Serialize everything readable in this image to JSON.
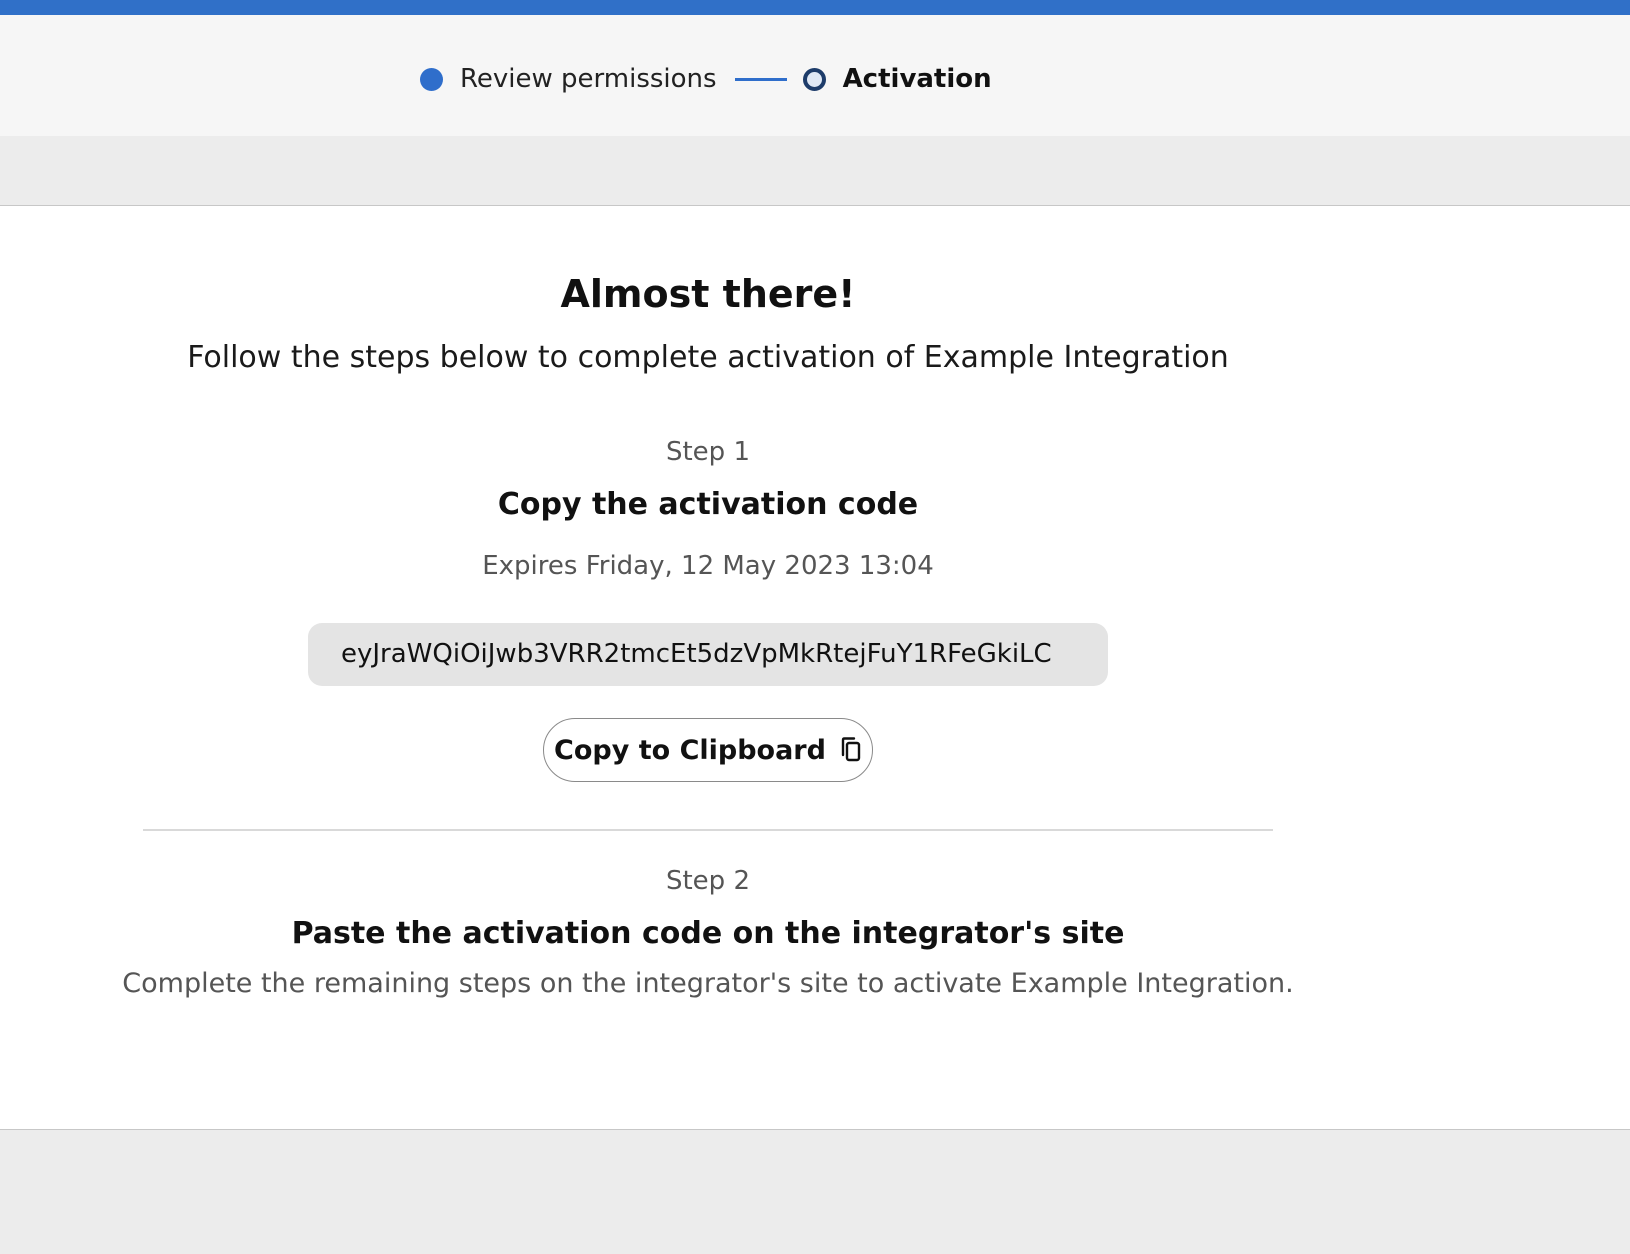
{
  "stepper": {
    "steps": [
      {
        "label": "Review permissions",
        "state": "completed"
      },
      {
        "label": "Activation",
        "state": "current"
      }
    ]
  },
  "main": {
    "title": "Almost there!",
    "subtitle": "Follow the steps below to complete activation of Example Integration"
  },
  "step1": {
    "number": "Step 1",
    "heading": "Copy the activation code",
    "expires": "Expires Friday, 12 May 2023 13:04",
    "code": "eyJraWQiOiJwb3VRR2tmcEt5dzVpMkRtejFuY1RFeGkiLC",
    "copy_button_label": "Copy to Clipboard",
    "copy_icon": "copy-icon"
  },
  "step2": {
    "number": "Step 2",
    "heading": "Paste the activation code on the integrator's site",
    "description": "Complete the remaining steps on the integrator's site to activate Example Integration."
  },
  "colors": {
    "accent": "#3070c8",
    "header_bg": "#f6f6f6",
    "page_bg": "#ececec",
    "code_bg": "#e4e4e4"
  }
}
